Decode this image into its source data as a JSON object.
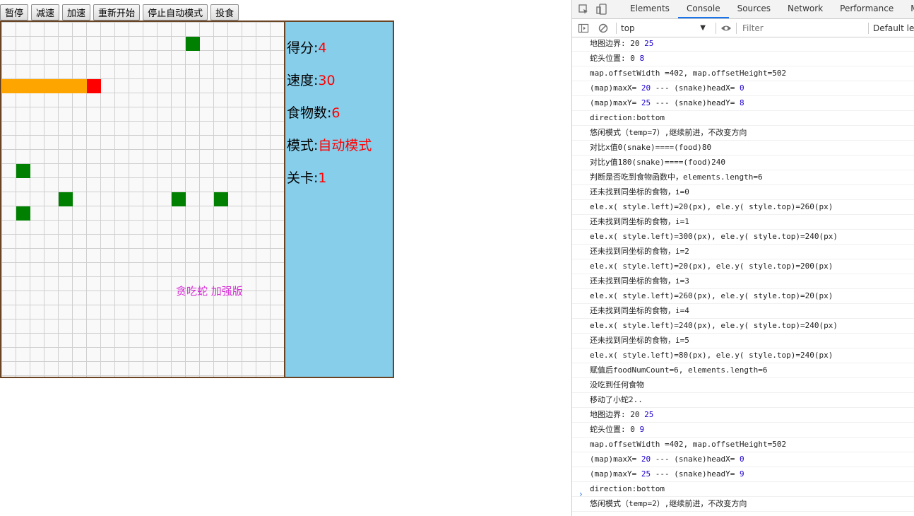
{
  "toolbar": {
    "buttons": [
      "暂停",
      "减速",
      "加速",
      "重新开始",
      "停止自动模式",
      "投食"
    ]
  },
  "game": {
    "caption": "贪吃蛇 加强版",
    "colors": {
      "snake_body": "#ffa500",
      "snake_head": "#ff0000",
      "food": "#008000"
    },
    "snake": {
      "head": [
        6,
        4
      ],
      "body": [
        [
          0,
          4
        ],
        [
          1,
          4
        ],
        [
          2,
          4
        ],
        [
          3,
          4
        ],
        [
          4,
          4
        ],
        [
          5,
          4
        ]
      ]
    },
    "food": [
      [
        13,
        1
      ],
      [
        1,
        10
      ],
      [
        4,
        12
      ],
      [
        12,
        12
      ],
      [
        15,
        12
      ],
      [
        1,
        13
      ]
    ]
  },
  "panel": {
    "stats": [
      {
        "label": "得分:",
        "value": "4"
      },
      {
        "label": "速度:",
        "value": "30"
      },
      {
        "label": "食物数:",
        "value": "6"
      },
      {
        "label": "模式:",
        "value": "自动模式"
      },
      {
        "label": "关卡:",
        "value": "1"
      }
    ]
  },
  "devtools": {
    "tabs": [
      "Elements",
      "Console",
      "Sources",
      "Network",
      "Performance",
      "Memory"
    ],
    "active_tab": "Console",
    "context": "top",
    "filter_placeholder": "Filter",
    "levels": "Default le",
    "console_lines": [
      [
        "地图边界: 20 ",
        "25",
        ""
      ],
      [
        "蛇头位置: 0 ",
        "8",
        ""
      ],
      [
        "map.offsetWidth =402, map.offsetHeight=502",
        "",
        ""
      ],
      [
        "(map)maxX= ",
        "20",
        " --- (snake)headX= ",
        "0"
      ],
      [
        "(map)maxY= ",
        "25",
        " --- (snake)headY= ",
        "8"
      ],
      [
        "direction:bottom",
        "",
        ""
      ],
      [
        "悠闲模式（temp=7）,继续前进，不改变方向",
        "",
        ""
      ],
      [
        "对比x值0(snake)====(food)80",
        "",
        ""
      ],
      [
        "对比y值180(snake)====(food)240",
        "",
        ""
      ],
      [
        "判断是否吃到食物函数中，elements.length=6",
        "",
        ""
      ],
      [
        "还未找到同坐标的食物，i=0",
        "",
        ""
      ],
      [
        "ele.x( style.left)=20(px), ele.y( style.top)=260(px)",
        "",
        ""
      ],
      [
        "还未找到同坐标的食物，i=1",
        "",
        ""
      ],
      [
        "ele.x( style.left)=300(px), ele.y( style.top)=240(px)",
        "",
        ""
      ],
      [
        "还未找到同坐标的食物，i=2",
        "",
        ""
      ],
      [
        "ele.x( style.left)=20(px), ele.y( style.top)=200(px)",
        "",
        ""
      ],
      [
        "还未找到同坐标的食物，i=3",
        "",
        ""
      ],
      [
        "ele.x( style.left)=260(px), ele.y( style.top)=20(px)",
        "",
        ""
      ],
      [
        "还未找到同坐标的食物，i=4",
        "",
        ""
      ],
      [
        "ele.x( style.left)=240(px), ele.y( style.top)=240(px)",
        "",
        ""
      ],
      [
        "还未找到同坐标的食物，i=5",
        "",
        ""
      ],
      [
        "ele.x( style.left)=80(px), ele.y( style.top)=240(px)",
        "",
        ""
      ],
      [
        "赋值后foodNumCount=6, elements.length=6",
        "",
        ""
      ],
      [
        "没吃到任何食物",
        "",
        ""
      ],
      [
        "移动了小蛇2..",
        "",
        ""
      ],
      [
        "地图边界: 20 ",
        "25",
        ""
      ],
      [
        "蛇头位置: 0 ",
        "9",
        ""
      ],
      [
        "map.offsetWidth =402, map.offsetHeight=502",
        "",
        ""
      ],
      [
        "(map)maxX= ",
        "20",
        " --- (snake)headX= ",
        "0"
      ],
      [
        "(map)maxY= ",
        "25",
        " --- (snake)headY= ",
        "9"
      ],
      [
        "direction:bottom",
        "",
        ""
      ],
      [
        "悠闲模式（temp=2）,继续前进，不改变方向",
        "",
        ""
      ]
    ],
    "prompt_symbol": "›"
  }
}
